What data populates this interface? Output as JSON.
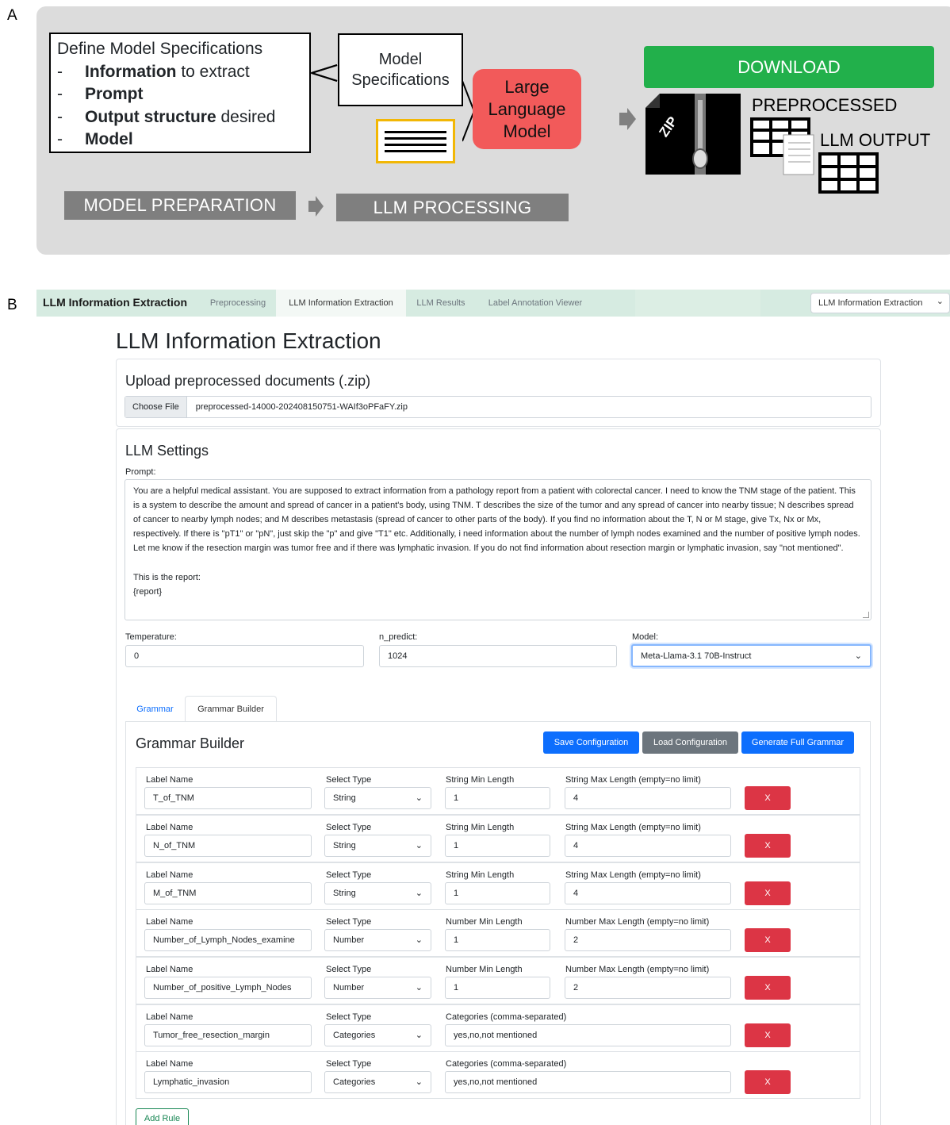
{
  "panel_labels": {
    "a": "A",
    "b": "B"
  },
  "panel_a": {
    "spec_box": {
      "title": "Define Model Specifications",
      "items": [
        {
          "dash": "-",
          "bold": "Information",
          "rest": " to extract"
        },
        {
          "dash": "-",
          "bold": "Prompt",
          "rest": ""
        },
        {
          "dash": "-",
          "bold": "Output structure",
          "rest": " desired"
        },
        {
          "dash": "-",
          "bold": "Model",
          "rest": ""
        }
      ]
    },
    "model_spec_box": {
      "line1": "Model",
      "line2": "Specifications"
    },
    "llm_box": {
      "line1": "Large",
      "line2": "Language",
      "line3": "Model"
    },
    "download_label": "DOWNLOAD",
    "zip_label": "ZIP",
    "preprocessed_label": "PREPROCESSED",
    "llm_output_label": "LLM OUTPUT",
    "model_preparation": "MODEL PREPARATION",
    "llm_processing": "LLM PROCESSING",
    "colors": {
      "panel_bg": "#dcdcdc",
      "llm_red": "#f25a5a",
      "download_green": "#22b04b",
      "doc_yellow": "#f2b705",
      "bar_gray": "#7f7f7f"
    }
  },
  "navbar": {
    "brand": "LLM Information Extraction",
    "tabs": [
      {
        "label": "Preprocessing",
        "active": false
      },
      {
        "label": "LLM Information Extraction",
        "active": true
      },
      {
        "label": "LLM Results",
        "active": false
      },
      {
        "label": "Label Annotation Viewer",
        "active": false
      }
    ],
    "select_value": "LLM Information Extraction",
    "bg_color": "#d6ebe1"
  },
  "page_title": "LLM Information Extraction",
  "upload": {
    "title": "Upload preprocessed documents (.zip)",
    "button": "Choose File",
    "filename": "preprocessed-14000-202408150751-WAIf3oPFaFY.zip"
  },
  "settings": {
    "title": "LLM Settings",
    "prompt_label": "Prompt:",
    "prompt_text": "You are a helpful medical assistant. You are supposed to extract information from a pathology report from a patient with colorectal cancer. I need to know the TNM stage of the patient. This is a system to describe the amount and spread of cancer in a patient's body, using TNM. T describes the size of the tumor and any spread of cancer into nearby tissue; N describes spread of cancer to nearby lymph nodes; and M describes metastasis (spread of cancer to other parts of the body). If you find no information about the T, N or M stage, give Tx, Nx or Mx, respectively. If there is \"pT1\" or \"pN\", just skip the \"p\" and give \"T1\" etc. Additionally, i need information about the number of lymph nodes examined and the number of positive lymph nodes. Let me know if the resection margin was tumor free and if there was lymphatic invasion. If you do not find information about resection margin or lymphatic invasion, say \"not mentioned\".\n\nThis is the report:\n{report}",
    "temperature_label": "Temperature:",
    "temperature_value": "0",
    "n_predict_label": "n_predict:",
    "n_predict_value": "1024",
    "model_label": "Model:",
    "model_value": "Meta-Llama-3.1 70B-Instruct"
  },
  "tabs": {
    "grammar": "Grammar",
    "builder": "Grammar Builder"
  },
  "builder": {
    "title": "Grammar Builder",
    "save": "Save Configuration",
    "load": "Load Configuration",
    "generate": "Generate Full Grammar",
    "add_rule": "Add Rule",
    "remove": "X",
    "label_name": "Label Name",
    "select_type": "Select Type",
    "rules": [
      {
        "name": "T_of_TNM",
        "type": "String",
        "min_label": "String Min Length",
        "min": "1",
        "max_label": "String Max Length (empty=no limit)",
        "max": "4"
      },
      {
        "name": "N_of_TNM",
        "type": "String",
        "min_label": "String Min Length",
        "min": "1",
        "max_label": "String Max Length (empty=no limit)",
        "max": "4"
      },
      {
        "name": "M_of_TNM",
        "type": "String",
        "min_label": "String Min Length",
        "min": "1",
        "max_label": "String Max Length (empty=no limit)",
        "max": "4"
      },
      {
        "name": "Number_of_Lymph_Nodes_examine",
        "type": "Number",
        "min_label": "Number Min Length",
        "min": "1",
        "max_label": "Number Max Length (empty=no limit)",
        "max": "2"
      },
      {
        "name": "Number_of_positive_Lymph_Nodes",
        "type": "Number",
        "min_label": "Number Min Length",
        "min": "1",
        "max_label": "Number Max Length (empty=no limit)",
        "max": "2"
      },
      {
        "name": "Tumor_free_resection_margin",
        "type": "Categories",
        "cat_label": "Categories (comma-separated)",
        "categories": "yes,no,not mentioned"
      },
      {
        "name": "Lymphatic_invasion",
        "type": "Categories",
        "cat_label": "Categories (comma-separated)",
        "categories": "yes,no,not mentioned"
      }
    ]
  }
}
